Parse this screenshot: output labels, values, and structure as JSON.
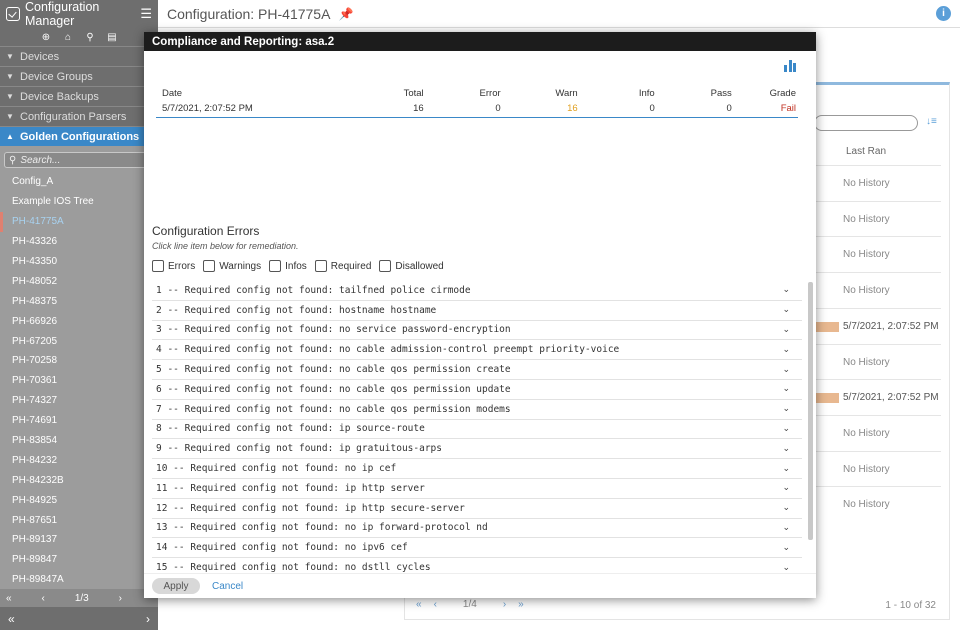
{
  "app": {
    "title": "Configuration Manager"
  },
  "sidebar": {
    "nav": [
      {
        "label": "Devices",
        "active": false
      },
      {
        "label": "Device Groups",
        "active": false
      },
      {
        "label": "Device Backups",
        "active": false
      },
      {
        "label": "Configuration Parsers",
        "active": false
      },
      {
        "label": "Golden Configurations",
        "active": true
      }
    ],
    "search_placeholder": "Search...",
    "items": [
      "Config_A",
      "Example IOS Tree",
      "PH-41775A",
      "PH-43326",
      "PH-43350",
      "PH-48052",
      "PH-48375",
      "PH-66926",
      "PH-67205",
      "PH-70258",
      "PH-70361",
      "PH-74327",
      "PH-74691",
      "PH-83854",
      "PH-84232",
      "PH-84232B",
      "PH-84925",
      "PH-87651",
      "PH-89137",
      "PH-89847",
      "PH-89847A"
    ],
    "selected_index": 2,
    "pager": "1/3"
  },
  "header": {
    "title": "Configuration: PH-41775A"
  },
  "background": {
    "last_ran_label": "Last Ran",
    "rows": [
      "No History",
      "No History",
      "No History",
      "No History",
      "5/7/2021, 2:07:52 PM",
      "No History",
      "5/7/2021, 2:07:52 PM",
      "No History",
      "No History",
      "No History"
    ],
    "pager": "1/4",
    "count": "1 - 10 of 32"
  },
  "modal": {
    "title": "Compliance and Reporting: asa.2",
    "summary": {
      "headers": [
        "Date",
        "Total",
        "Error",
        "Warn",
        "Info",
        "Pass",
        "Grade"
      ],
      "row": [
        "5/7/2021, 2:07:52 PM",
        "16",
        "0",
        "16",
        "0",
        "0",
        "Fail"
      ]
    },
    "errors_title": "Configuration Errors",
    "errors_subtitle": "Click line item below for remediation.",
    "filters": [
      "Errors",
      "Warnings",
      "Infos",
      "Required",
      "Disallowed"
    ],
    "errors": [
      "1 -- Required config not found: tailfned police cirmode",
      "2 -- Required config not found: hostname hostname",
      "3 -- Required config not found: no service password-encryption",
      "4 -- Required config not found: no cable admission-control preempt priority-voice",
      "5 -- Required config not found: no cable qos permission create",
      "6 -- Required config not found: no cable qos permission update",
      "7 -- Required config not found: no cable qos permission modems",
      "8 -- Required config not found: ip source-route",
      "9 -- Required config not found: ip gratuitous-arps",
      "10 -- Required config not found: no ip cef",
      "11 -- Required config not found: ip http server",
      "12 -- Required config not found: ip http secure-server",
      "13 -- Required config not found: no ip forward-protocol nd",
      "14 -- Required config not found: no ipv6 cef",
      "15 -- Required config not found: no dstll cycles"
    ],
    "apply_label": "Apply",
    "cancel_label": "Cancel"
  },
  "colors": {
    "accent": "#3a88c8",
    "warn": "#e0a020",
    "fail": "#c03020"
  }
}
